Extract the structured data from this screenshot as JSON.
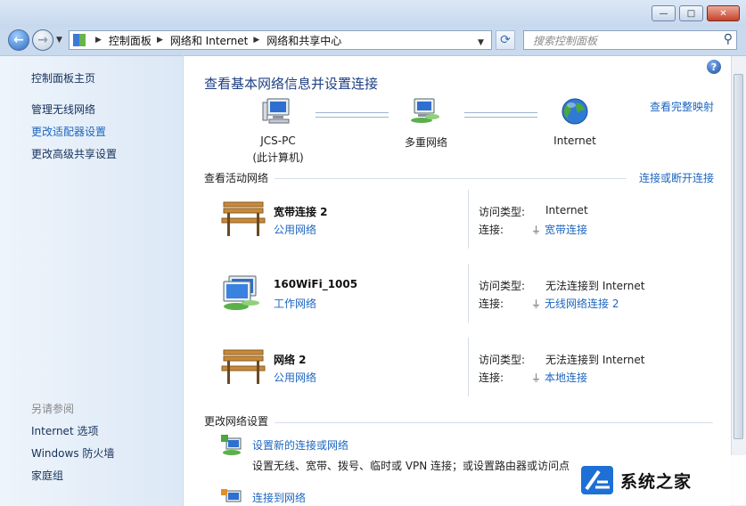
{
  "window": {
    "minimize": "—",
    "maximize": "□",
    "close": "✕"
  },
  "navbar": {
    "breadcrumbs": [
      "控制面板",
      "网络和 Internet",
      "网络和共享中心"
    ],
    "search_placeholder": "搜索控制面板"
  },
  "sidebar": {
    "home": "控制面板主页",
    "links": [
      "管理无线网络",
      "更改适配器设置",
      "更改高级共享设置"
    ],
    "see_also_heading": "另请参阅",
    "see_also": [
      "Internet 选项",
      "Windows 防火墙",
      "家庭组"
    ]
  },
  "main": {
    "title": "查看基本网络信息并设置连接",
    "view_full_map": "查看完整映射",
    "map_nodes": [
      {
        "label": "JCS-PC",
        "sub": "(此计算机)"
      },
      {
        "label": "多重网络",
        "sub": ""
      },
      {
        "label": "Internet",
        "sub": ""
      }
    ],
    "active_heading": "查看活动网络",
    "connect_disconnect": "连接或断开连接",
    "networks": [
      {
        "name": "宽带连接  2",
        "type": "公用网络",
        "icon": "park-bench-icon",
        "access_label": "访问类型:",
        "access": "Internet",
        "conn_label": "连接:",
        "connection": "宽带连接"
      },
      {
        "name": "160WiFi_1005",
        "type": "工作网络",
        "icon": "work-network-icon",
        "access_label": "访问类型:",
        "access": "无法连接到 Internet",
        "conn_label": "连接:",
        "connection": "无线网络连接 2"
      },
      {
        "name": "网络  2",
        "type": "公用网络",
        "icon": "park-bench-icon",
        "access_label": "访问类型:",
        "access": "无法连接到 Internet",
        "conn_label": "连接:",
        "connection": "本地连接"
      }
    ],
    "change_heading": "更改网络设置",
    "tasks": [
      {
        "title": "设置新的连接或网络",
        "desc": "设置无线、宽带、拨号、临时或 VPN 连接；或设置路由器或访问点"
      },
      {
        "title": "连接到网络",
        "desc": ""
      }
    ]
  },
  "watermark": {
    "text": "系统之家"
  }
}
